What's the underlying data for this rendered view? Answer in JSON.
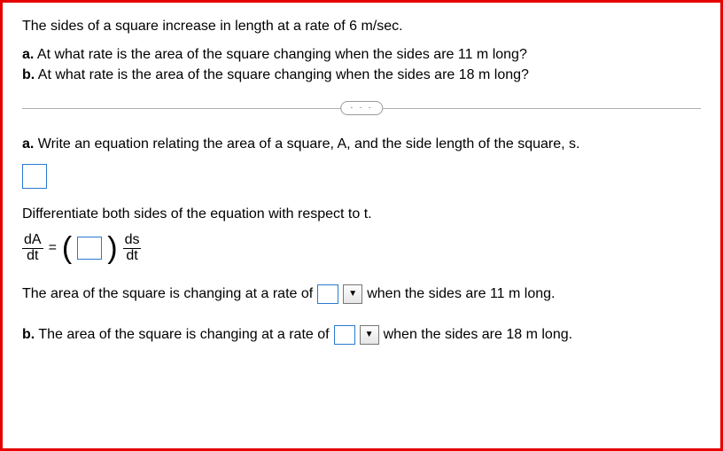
{
  "problem": {
    "intro": "The sides of a square increase in length at a rate of 6 m/sec.",
    "part_a_label": "a.",
    "part_a_text": " At what rate is the area of the square changing when the sides are 11 m long?",
    "part_b_label": "b.",
    "part_b_text": " At what rate is the area of the square changing when the sides are 18 m long?"
  },
  "divider": {
    "dots": "· · ·"
  },
  "work": {
    "eq_prompt_label": "a.",
    "eq_prompt_text": " Write an equation relating the area of a square, A, and the side length of the square, s.",
    "eq_input": "",
    "diff_prompt": "Differentiate both sides of the equation with respect to t.",
    "frac1_num": "dA",
    "frac1_den": "dt",
    "equals": "=",
    "lparen": "(",
    "coef_input": "",
    "rparen": ")",
    "frac2_num": "ds",
    "frac2_den": "dt"
  },
  "answers": {
    "a_pre": "The area of the square is changing at a rate of",
    "a_input": "",
    "a_post": "when the sides are 11 m long.",
    "b_label": "b.",
    "b_pre": " The area of the square is changing at a rate of",
    "b_input": "",
    "b_post": "when the sides are 18 m long.",
    "caret": "▼"
  }
}
